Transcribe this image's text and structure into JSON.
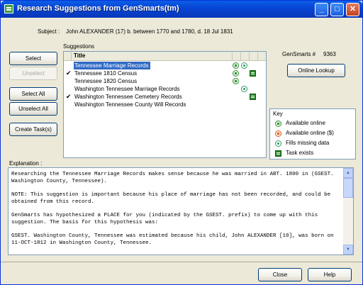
{
  "window": {
    "title": "Research Suggestions from GenSmarts(tm)",
    "controls": {
      "minimize": "_",
      "maximize": "□",
      "close": "✕"
    }
  },
  "subject": {
    "label": "Subject :",
    "value": "John ALEXANDER (17) b. between 1770 and 1780, d. 18 Jul 1831"
  },
  "suggestions": {
    "label": "Suggestions",
    "column_title": "Title",
    "rows": [
      {
        "check": "",
        "title": "Tennessee Marriage Records",
        "selected": true,
        "icons": [
          "available-online",
          "fills-missing-data"
        ]
      },
      {
        "check": "✔",
        "title": "Tennessee 1810 Census",
        "selected": false,
        "icons": [
          "available-online",
          "task-exists"
        ]
      },
      {
        "check": "",
        "title": "Tennessee 1820 Census",
        "selected": false,
        "icons": [
          "available-online"
        ]
      },
      {
        "check": "",
        "title": "Washington Tennessee Marriage Records",
        "selected": false,
        "icons": [
          "fills-missing-data"
        ]
      },
      {
        "check": "✔",
        "title": "Washington Tennessee Cemetery Records",
        "selected": false,
        "icons": [
          "task-exists"
        ]
      },
      {
        "check": "",
        "title": "Washington Tennessee County Will Records",
        "selected": false,
        "icons": []
      }
    ]
  },
  "buttons": {
    "select": "Select",
    "unselect": "Unselect",
    "select_all": "Select All",
    "unselect_all": "Unselect All",
    "create_tasks": "Create Task(s)",
    "online_lookup": "Online Lookup",
    "close": "Close",
    "help": "Help"
  },
  "gensmarts": {
    "label": "GenSmarts #",
    "number": "9363"
  },
  "key": {
    "title": "Key",
    "items": [
      {
        "icon": "available-online",
        "label": "Available online"
      },
      {
        "icon": "available-online-paid",
        "label": "Available online ($)"
      },
      {
        "icon": "fills-missing-data",
        "label": "Fills missing data"
      },
      {
        "icon": "task-exists",
        "label": "Task exists"
      }
    ]
  },
  "explanation": {
    "label": "Explanation :",
    "paragraphs": [
      "Researching the Tennessee Marriage Records makes sense because he was married in ABT. 1800 in (GSEST. Washington County, Tennessee).",
      "NOTE: This suggestion is important because his place of marriage has not been recorded, and could be obtained from this record.",
      "GenSmarts has hypothesized a PLACE for you (indicated by the GSEST. prefix) to come up with this suggestion. The basis for this hypothesis was:",
      "GSEST. Washington County, Tennessee was estimated because his child, John ALEXANDER [10], was born on 11-OCT-1812 in Washington County, Tennessee."
    ]
  },
  "colors": {
    "titlebar": "#0846d6",
    "selection": "#316ac5",
    "window_bg": "#ece9d8",
    "online_icon": "#3a8f3a",
    "paid_icon": "#d06020",
    "task_icon": "#2a8a2a"
  }
}
